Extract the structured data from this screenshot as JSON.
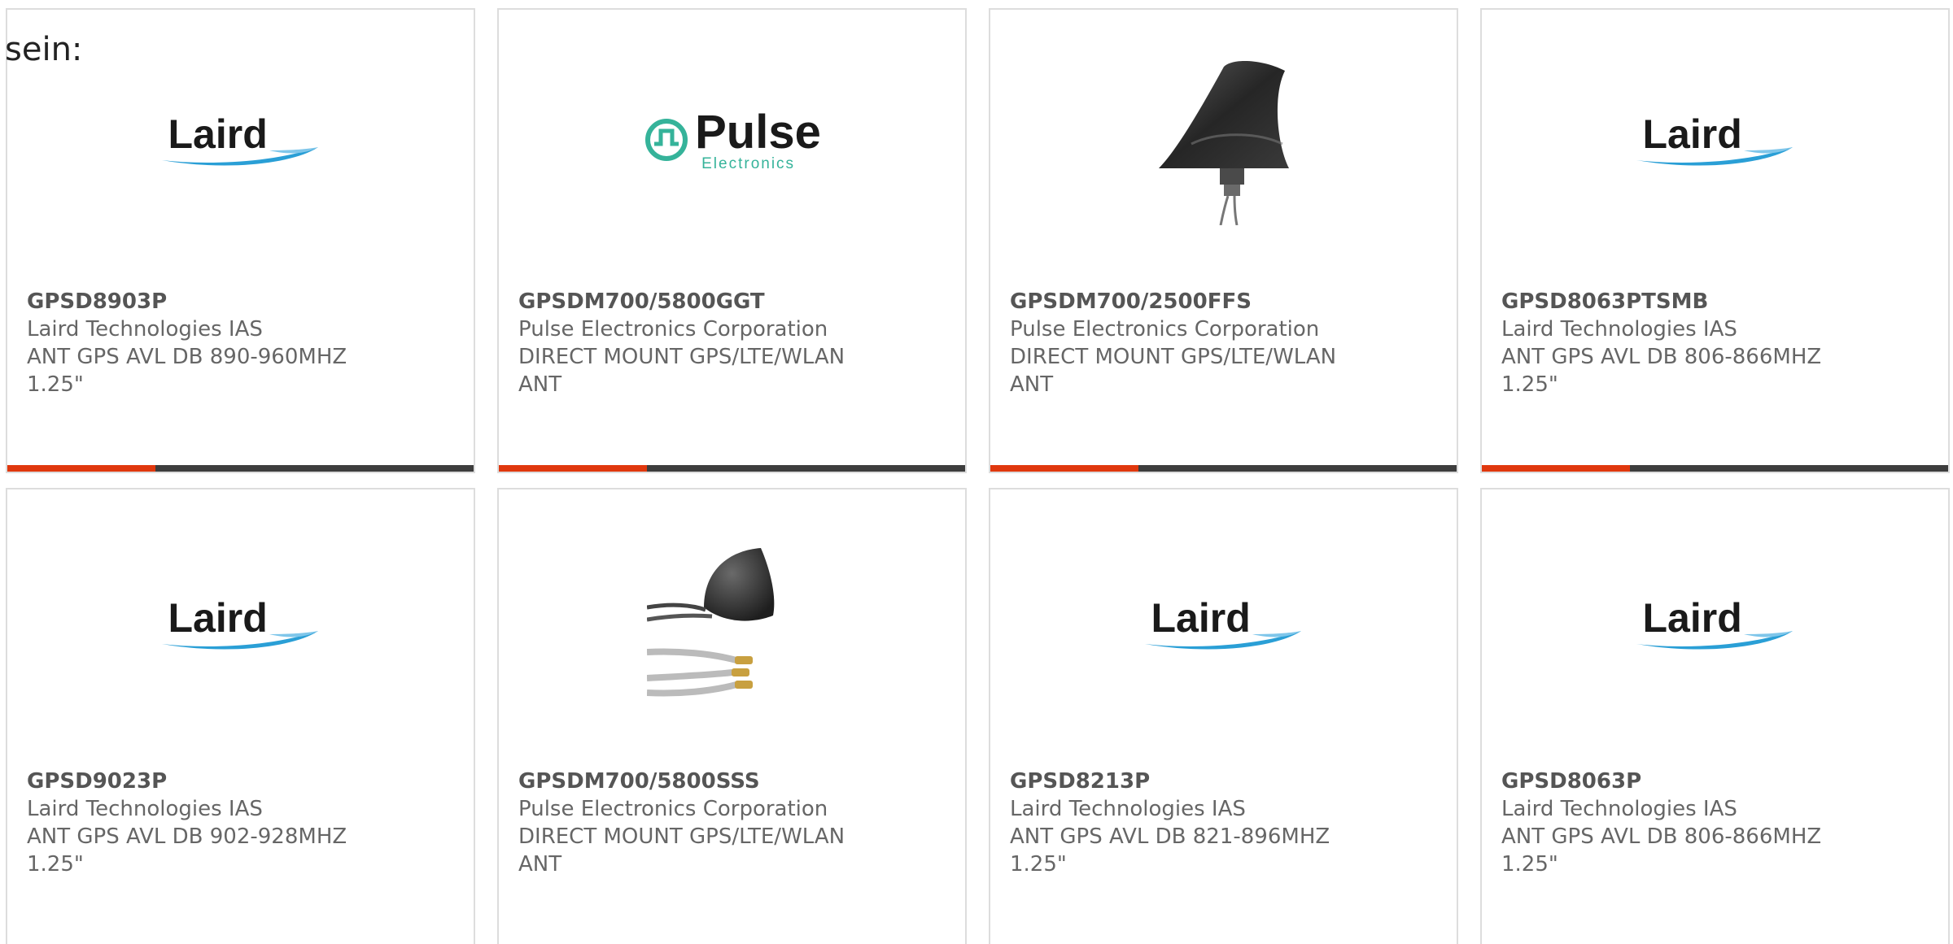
{
  "intro_text": "sein:",
  "colors": {
    "accent": "#e0380e",
    "bar": "#3d3d3d",
    "border": "#dddddd",
    "text": "#666666",
    "laird_swoosh": "#2a9fd6",
    "pulse_green": "#35b39a"
  },
  "products": [
    {
      "part_number": "GPSD8903P",
      "manufacturer": "Laird Technologies IAS",
      "description": "ANT GPS AVL DB 890-960MHZ 1.25\"",
      "image": "laird-logo"
    },
    {
      "part_number": "GPSDM700/5800GGT",
      "manufacturer": "Pulse Electronics Corporation",
      "description": "DIRECT MOUNT GPS/LTE/WLAN ANT",
      "image": "pulse-electronics-logo",
      "logo_word": "Pulse",
      "logo_sub": "Electronics"
    },
    {
      "part_number": "GPSDM700/2500FFS",
      "manufacturer": "Pulse Electronics Corporation",
      "description": "DIRECT MOUNT GPS/LTE/WLAN ANT",
      "image": "shark-fin-antenna-photo"
    },
    {
      "part_number": "GPSD8063PTSMB",
      "manufacturer": "Laird Technologies IAS",
      "description": "ANT GPS AVL DB 806-866MHZ 1.25\"",
      "image": "laird-logo"
    },
    {
      "part_number": "GPSD9023P",
      "manufacturer": "Laird Technologies IAS",
      "description": "ANT GPS AVL DB 902-928MHZ 1.25\"",
      "image": "laird-logo"
    },
    {
      "part_number": "GPSDM700/5800SSS",
      "manufacturer": "Pulse Electronics Corporation",
      "description": "DIRECT MOUNT GPS/LTE/WLAN ANT",
      "image": "puck-antenna-with-cables-photo"
    },
    {
      "part_number": "GPSD8213P",
      "manufacturer": "Laird Technologies IAS",
      "description": "ANT GPS AVL DB 821-896MHZ 1.25\"",
      "image": "laird-logo"
    },
    {
      "part_number": "GPSD8063P",
      "manufacturer": "Laird Technologies IAS",
      "description": "ANT GPS AVL DB 806-866MHZ 1.25\"",
      "image": "laird-logo"
    }
  ],
  "laird_logo_word": "Laird"
}
